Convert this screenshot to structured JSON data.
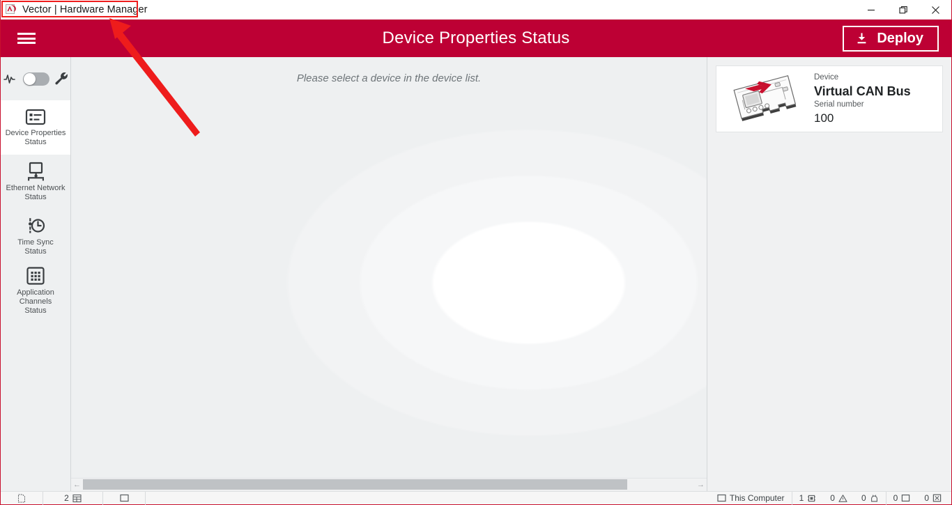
{
  "window": {
    "title": "Vector | Hardware Manager",
    "app_icon": "vector-logo-icon",
    "minimize_label": "–",
    "restore_label": "❐",
    "close_label": "✕"
  },
  "header": {
    "menu_icon": "hamburger-menu-icon",
    "page_title": "Device Properties Status",
    "deploy_label": "Deploy",
    "deploy_icon": "download-icon",
    "background_color": "#bd0034"
  },
  "sidebar": {
    "toggle": {
      "left_icon": "pulse-wave-icon",
      "right_icon": "wrench-icon",
      "state": "off"
    },
    "items": [
      {
        "label": "Device Properties\nStatus",
        "icon": "device-properties-icon",
        "active": true
      },
      {
        "label": "Ethernet Network\nStatus",
        "icon": "monitor-network-icon",
        "active": false
      },
      {
        "label": "Time Sync\nStatus",
        "icon": "clock-sync-icon",
        "active": false
      },
      {
        "label": "Application Channels\nStatus",
        "icon": "grid-channels-icon",
        "active": false
      }
    ]
  },
  "main": {
    "empty_message": "Please select a device in the device list.",
    "scrollbar": {
      "left_arrow": "←",
      "right_arrow": "→"
    }
  },
  "device_panel": {
    "card": {
      "image_icon": "can-interface-board-icon",
      "device_label": "Device",
      "device_name": "Virtual CAN Bus",
      "serial_label": "Serial number",
      "serial_value": "100"
    }
  },
  "statusbar": {
    "cells": [
      {
        "icon": "document-icon",
        "value": ""
      },
      {
        "icon": "table-icon",
        "value": "2"
      },
      {
        "icon": "square-icon",
        "value": ""
      }
    ],
    "computer_label": "This Computer",
    "computer_icon": "monitor-icon",
    "counters": [
      {
        "value": "1",
        "icon": "device-count-icon"
      },
      {
        "value": "0",
        "icon": "warning-triangle-icon"
      },
      {
        "value": "0",
        "icon": "plug-icon"
      },
      {
        "value": "0",
        "icon": "window-icon"
      },
      {
        "value": "0",
        "icon": "boxed-x-icon"
      }
    ]
  },
  "annotation": {
    "color": "#ee1c1c",
    "target": "window-title"
  }
}
